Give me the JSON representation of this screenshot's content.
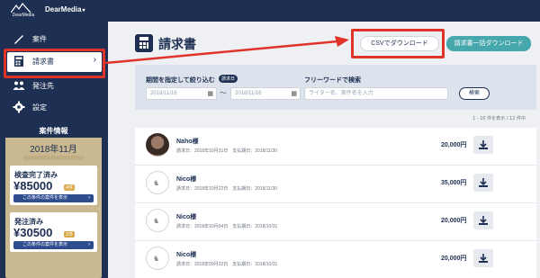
{
  "app": {
    "logo_text": "DearMedia",
    "workspace": "DearMedia"
  },
  "sidebar": {
    "items": [
      {
        "label": "案件",
        "icon": "pen-icon"
      },
      {
        "label": "請求書",
        "icon": "invoice-icon"
      },
      {
        "label": "発注先",
        "icon": "people-icon"
      },
      {
        "label": "設定",
        "icon": "gear-icon"
      }
    ]
  },
  "info": {
    "title": "案件情報",
    "month": "2018年11月",
    "card1": {
      "title": "検査完了済み",
      "amount": "¥85000",
      "count": "4件",
      "button": "この条件の案件を表示"
    },
    "card2": {
      "title": "発注済み",
      "amount": "¥30500",
      "count": "2件",
      "button": "この条件の案件を表示"
    }
  },
  "main": {
    "title": "請求書",
    "csv_button": "CSVでダウンロード",
    "bulk_button": "請求書一括ダウンロード"
  },
  "filter": {
    "period_label": "期間を指定して絞り込む",
    "period_badge": "請求日",
    "date_from": "2018/11/16",
    "date_to": "2018/11/16",
    "tilde": "〜",
    "keyword_label": "フリーワードで検索",
    "keyword_placeholder": "ライター名、案件名を入力",
    "search_button": "検索"
  },
  "result_count": "1 - 10 件を表示 / 12 件中",
  "invoices": [
    {
      "name": "Naho様",
      "dates": "請求日：2018年10月31日　支払期日：2018/11/30",
      "amount": "20,000円"
    },
    {
      "name": "Nico様",
      "dates": "請求日：2018年10月22日　支払期日：2018/11/30",
      "amount": "35,000円"
    },
    {
      "name": "Nico様",
      "dates": "請求日：2018年10月04日　支払期日：2018/10/31",
      "amount": "20,000円"
    },
    {
      "name": "Nico様",
      "dates": "請求日：2018年09月22日　支払期日：2018/10/31",
      "amount": "20,000円"
    }
  ],
  "colors": {
    "navy": "#1d2f52",
    "teal": "#46a7ad",
    "highlight": "#e0342a",
    "gold": "#c9b890"
  }
}
